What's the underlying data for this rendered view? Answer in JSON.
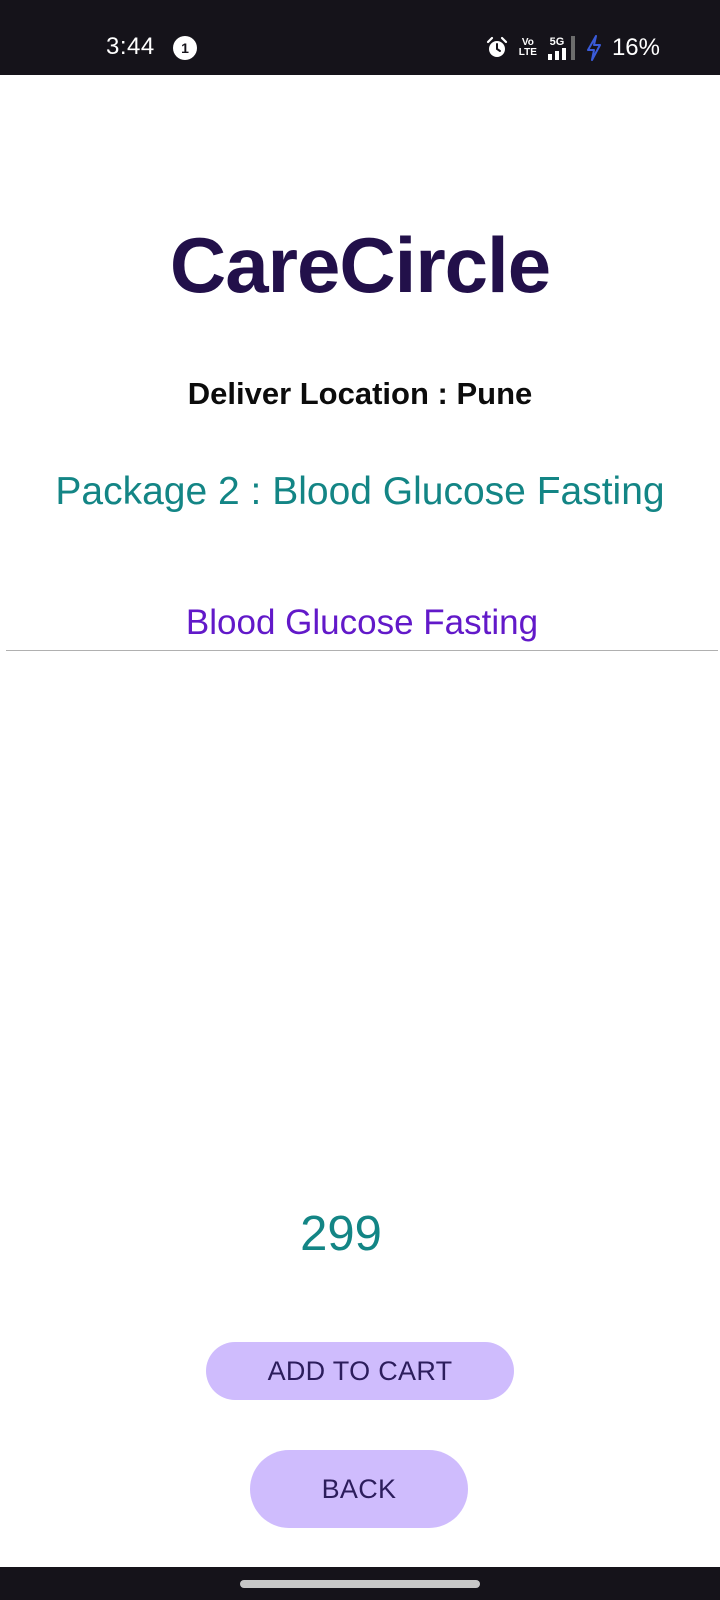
{
  "status_bar": {
    "time": "3:44",
    "notification_count": "1",
    "network_label": "5G",
    "volte_label_top": "Vo",
    "volte_label_bottom": "LTE",
    "battery": "16%"
  },
  "app": {
    "title": "CareCircle"
  },
  "location": {
    "text": "Deliver Location : Pune"
  },
  "package": {
    "title": "Package 2 : Blood Glucose Fasting",
    "field_value": "Blood Glucose Fasting",
    "price": "299"
  },
  "actions": {
    "add_to_cart": "ADD TO CART",
    "back": "BACK"
  },
  "colors": {
    "title": "#22104a",
    "teal_text": "#138585",
    "field_text": "#6219c9",
    "button_bg": "#cfbcfd",
    "button_text": "#2c1d5c",
    "status_bar_bg": "#15131a",
    "charging_bolt": "#3a5bd9"
  }
}
